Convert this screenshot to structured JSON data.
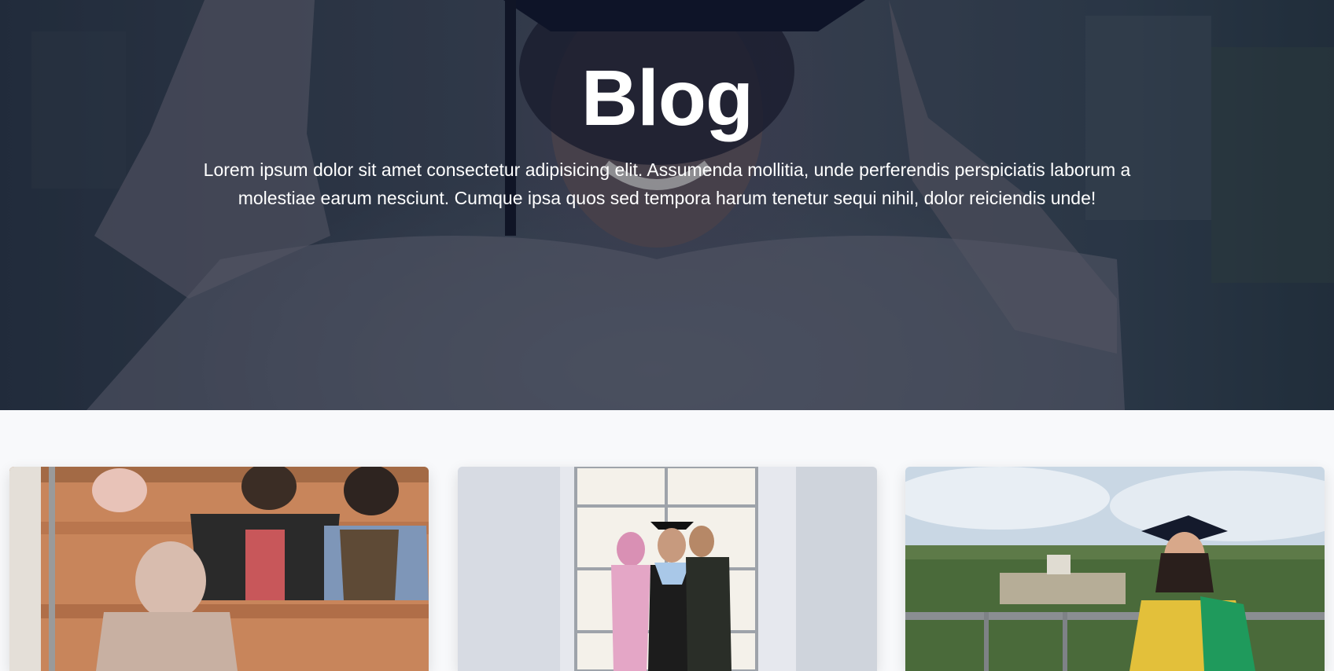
{
  "hero": {
    "title": "Blog",
    "subtitle": "Lorem ipsum dolor sit amet consectetur adipisicing elit. Assumenda mollitia, unde perferendis perspiciatis laborum a molestiae earum nesciunt. Cumque ipsa quos sed tempora harum tenetur sequi nihil, dolor reiciendis unde!"
  },
  "posts": [
    {
      "image": "students-in-lecture-hall-photo"
    },
    {
      "image": "graduate-with-parents-photo"
    },
    {
      "image": "graduate-overlooking-city-photo"
    }
  ],
  "colors": {
    "hero_overlay": "#0a1028",
    "page_background": "#f8f9fb",
    "text_on_hero": "#ffffff"
  }
}
